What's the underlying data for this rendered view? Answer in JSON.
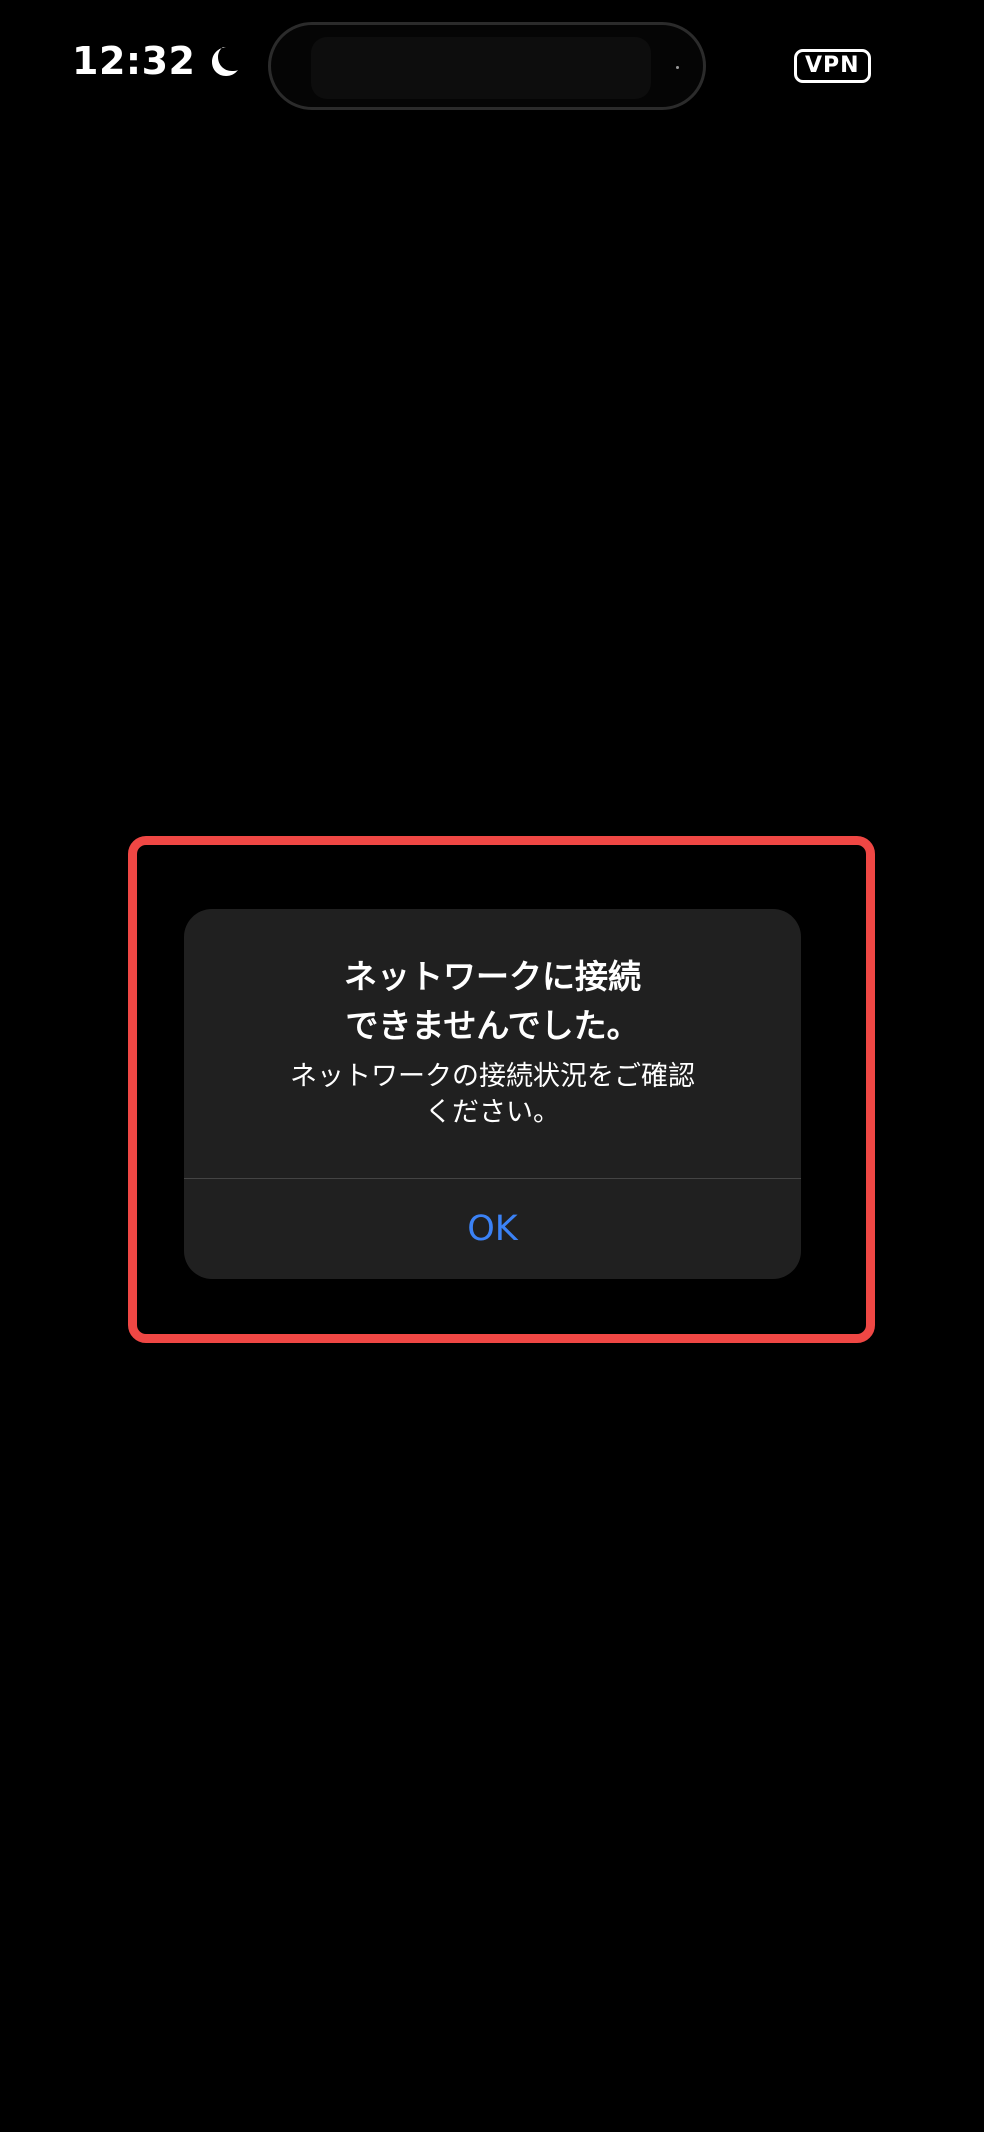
{
  "status_bar": {
    "time": "12:32",
    "moon_icon": "moon-icon",
    "vpn_label": "VPN"
  },
  "alert": {
    "title": "ネットワークに接続\nできませんでした。",
    "message": "ネットワークの接続状況をご確認\nください。",
    "ok_button": "OK"
  },
  "colors": {
    "background": "#000000",
    "alert_background": "#202020",
    "accent": "#3b82f6",
    "highlight": "#ef4744"
  }
}
